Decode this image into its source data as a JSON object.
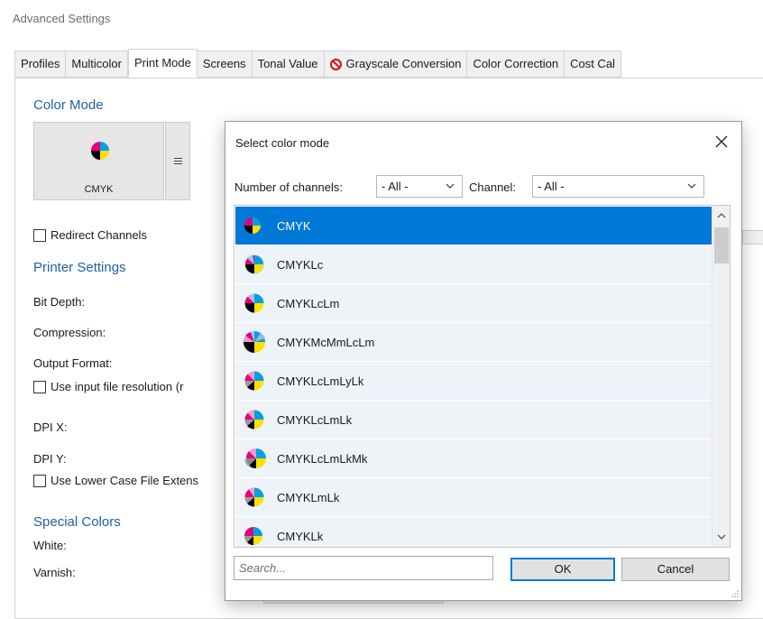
{
  "window_title": "Advanced Settings",
  "tabs": [
    {
      "label": "Profiles"
    },
    {
      "label": "Multicolor"
    },
    {
      "label": "Print Mode",
      "active": true
    },
    {
      "label": "Screens"
    },
    {
      "label": "Tonal Value"
    },
    {
      "label": "Grayscale Conversion",
      "icon": "no-entry-icon"
    },
    {
      "label": "Color Correction"
    },
    {
      "label": "Cost Cal"
    }
  ],
  "left": {
    "color_mode_heading": "Color Mode",
    "color_mode_tile_label": "CMYK",
    "redirect_channels": "Redirect Channels",
    "printer_settings_heading": "Printer Settings",
    "bit_depth": "Bit Depth:",
    "compression": "Compression:",
    "output_format": "Output Format:",
    "use_input_resolution": "Use input file resolution (r",
    "dpi_x": "DPI X:",
    "dpi_y": "DPI Y:",
    "use_lower_case": "Use Lower Case File Extens",
    "special_colors_heading": "Special Colors",
    "white": "White:",
    "varnish": "Varnish:"
  },
  "dialog": {
    "title": "Select color mode",
    "channels_label": "Number of channels:",
    "channels_value": "- All -",
    "channel_label": "Channel:",
    "channel_value": "- All -",
    "items": [
      {
        "label": "CMYK",
        "selected": true
      },
      {
        "label": "CMYKLc"
      },
      {
        "label": "CMYKLcLm"
      },
      {
        "label": "CMYKMcMmLcLm"
      },
      {
        "label": "CMYKLcLmLyLk"
      },
      {
        "label": "CMYKLcLmLk"
      },
      {
        "label": "CMYKLcLmLkMk"
      },
      {
        "label": "CMYKLmLk"
      },
      {
        "label": "CMYKLk"
      }
    ],
    "search_placeholder": "Search...",
    "ok": "OK",
    "cancel": "Cancel"
  },
  "colors": {
    "accent": "#0078d7",
    "section_heading": "#1f5fa8",
    "cyan": "#00a0e3",
    "magenta": "#e4007c",
    "yellow": "#ffe100",
    "black": "#000000"
  }
}
